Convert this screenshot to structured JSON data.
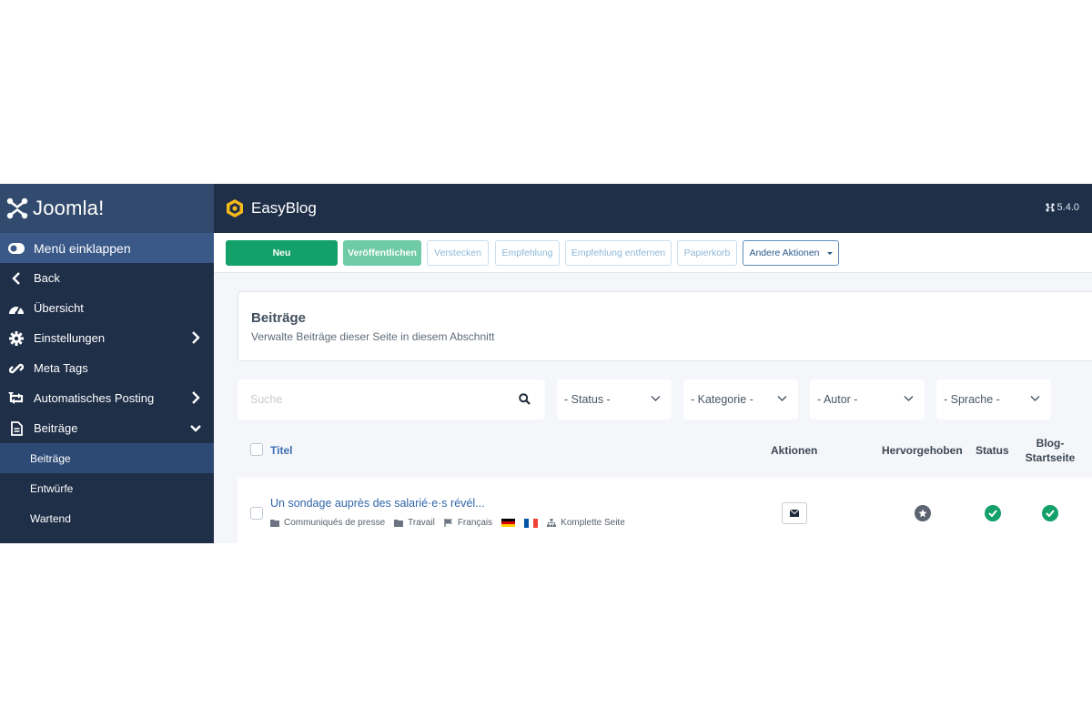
{
  "sidebar": {
    "logo_text": "Joomla!",
    "items": [
      {
        "label": "Menü einklappen"
      },
      {
        "label": "Back"
      },
      {
        "label": "Übersicht"
      },
      {
        "label": "Einstellungen"
      },
      {
        "label": "Meta Tags"
      },
      {
        "label": "Automatisches Posting"
      },
      {
        "label": "Beiträge"
      }
    ],
    "subitems": [
      {
        "label": "Beiträge"
      },
      {
        "label": "Entwürfe"
      },
      {
        "label": "Wartend"
      }
    ]
  },
  "header": {
    "title": "EasyBlog",
    "version": "5.4.0"
  },
  "toolbar": {
    "new": "Neu",
    "publish": "Veröffentlichen",
    "hide": "Verstecken",
    "feature": "Empfehlung",
    "unfeature": "Empfehlung entfernen",
    "trash": "Papierkorb",
    "other_actions": "Andere Aktionen"
  },
  "section": {
    "title": "Beiträge",
    "description": "Verwalte Beiträge dieser Seite in diesem Abschnitt"
  },
  "filters": {
    "search_placeholder": "Suche",
    "status": "- Status -",
    "category": "- Kategorie -",
    "author": "- Autor -",
    "language": "- Sprache -"
  },
  "table": {
    "columns": {
      "title": "Titel",
      "actions": "Aktionen",
      "featured": "Hervorgehoben",
      "status": "Status",
      "frontpage": "Blog-Startseite"
    },
    "rows": [
      {
        "title": "Un sondage auprès des salarié·e·s révél...",
        "category": "Communiqués de presse",
        "tag": "Travail",
        "language": "Français",
        "access": "Komplette Seite",
        "featured": false,
        "published": true,
        "frontpage": true
      }
    ]
  },
  "colors": {
    "sidebar_bg": "#1f2f48",
    "primary_green": "#13a069",
    "link_blue": "#2f65a8",
    "status_green": "#13a069",
    "featured_gray": "#5b6470"
  }
}
